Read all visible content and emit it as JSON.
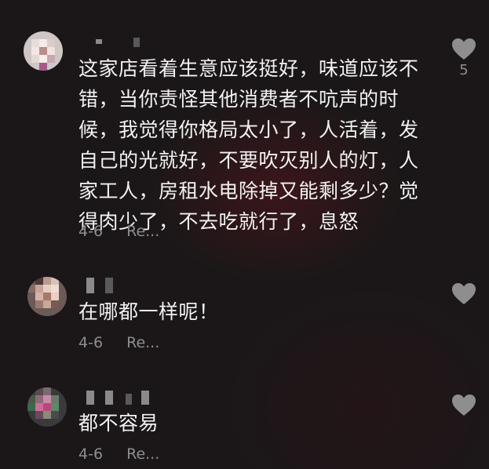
{
  "comments": [
    {
      "text": "这家店看着生意应该挺好，味道应该不错，当你责怪其他消费者不吭声的时候，我觉得你格局太小了，人活着，发自己的光就好，不要吹灭别人的灯，人家工人，房租水电除掉又能剩多少？觉得肉少了，不去吃就行了，息怒",
      "date": "4-6",
      "reply_label": "Re...",
      "likes": "5",
      "heart_icon": "heart-icon"
    },
    {
      "text": "在哪都一样呢！",
      "date": "4-6",
      "reply_label": "Re...",
      "likes": "",
      "heart_icon": "heart-icon"
    },
    {
      "text": "都不容易",
      "date": "4-6",
      "reply_label": "Re...",
      "likes": "",
      "heart_icon": "heart-icon"
    }
  ],
  "colors": {
    "background": "#1b1718",
    "text": "#f2f2f2",
    "meta": "#8e8e90",
    "heart": "#8e8e90"
  }
}
